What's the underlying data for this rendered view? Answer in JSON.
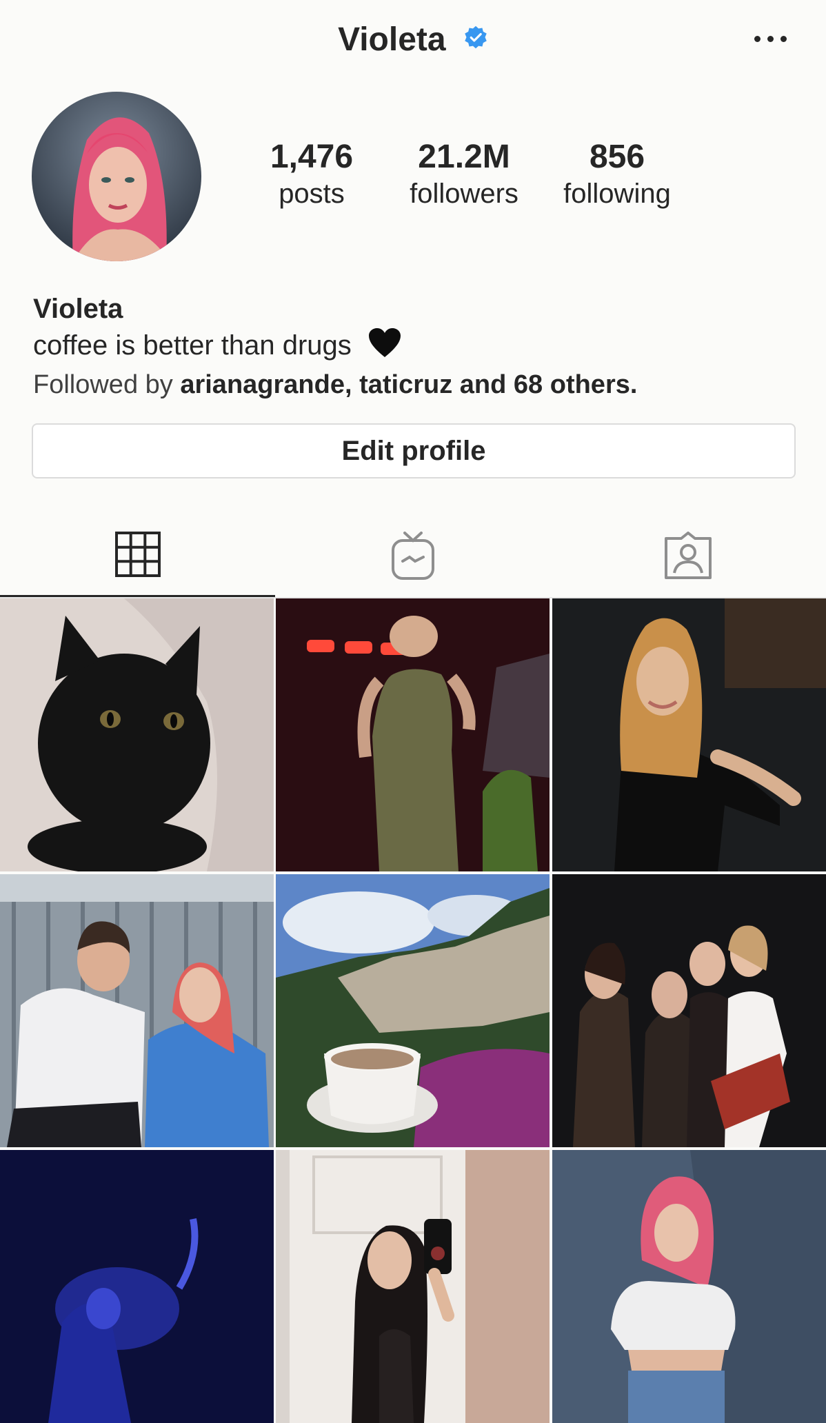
{
  "header": {
    "username": "Violeta",
    "verified_icon": "verified-badge-icon",
    "more_icon": "more-options-icon"
  },
  "stats": [
    {
      "value": "1,476",
      "label": "posts"
    },
    {
      "value": "21.2M",
      "label": "followers"
    },
    {
      "value": "856",
      "label": "following"
    }
  ],
  "bio": {
    "name": "Violeta",
    "text": "coffee is better than drugs",
    "emoji_icon": "black-heart-icon",
    "followed_prefix": "Followed by",
    "followed_names": "arianagrande, taticruz and 68 others."
  },
  "edit_profile_label": "Edit profile",
  "tabs": [
    {
      "icon": "grid-icon",
      "active": true
    },
    {
      "icon": "igtv-icon",
      "active": false
    },
    {
      "icon": "tagged-icon",
      "active": false
    }
  ],
  "colors": {
    "background": "#fbfbf9",
    "text": "#262626",
    "verified": "#3897f0",
    "border": "#dbdbdb"
  }
}
